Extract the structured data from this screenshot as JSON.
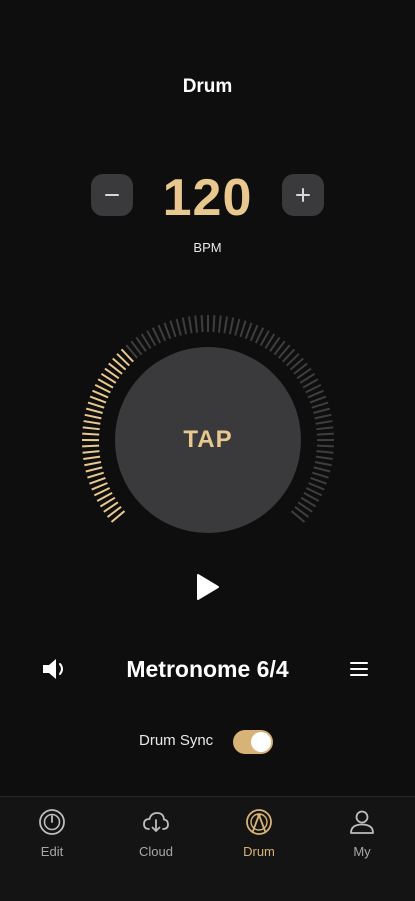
{
  "header": {
    "title": "Drum"
  },
  "tempo": {
    "minus_label": "−",
    "plus_label": "+",
    "value": "120",
    "unit": "BPM"
  },
  "dial": {
    "tap_label": "TAP",
    "progress_fraction": 0.33,
    "active_color": "#e8c88f",
    "inactive_color": "#3e3e3e"
  },
  "player": {
    "play_icon": "play-icon"
  },
  "metronome": {
    "title": "Metronome 6/4",
    "volume_icon": "volume-icon",
    "menu_icon": "menu-icon"
  },
  "sync": {
    "label": "Drum Sync",
    "enabled": true
  },
  "tabs": [
    {
      "label": "Edit",
      "icon": "edit-knob-icon",
      "active": false
    },
    {
      "label": "Cloud",
      "icon": "cloud-icon",
      "active": false
    },
    {
      "label": "Drum",
      "icon": "drum-icon",
      "active": true
    },
    {
      "label": "My",
      "icon": "user-icon",
      "active": false
    }
  ],
  "colors": {
    "background": "#0e0e0e",
    "accent": "#e8c88f",
    "button": "#3a3a3c",
    "tab_inactive": "#a8a8a8"
  }
}
